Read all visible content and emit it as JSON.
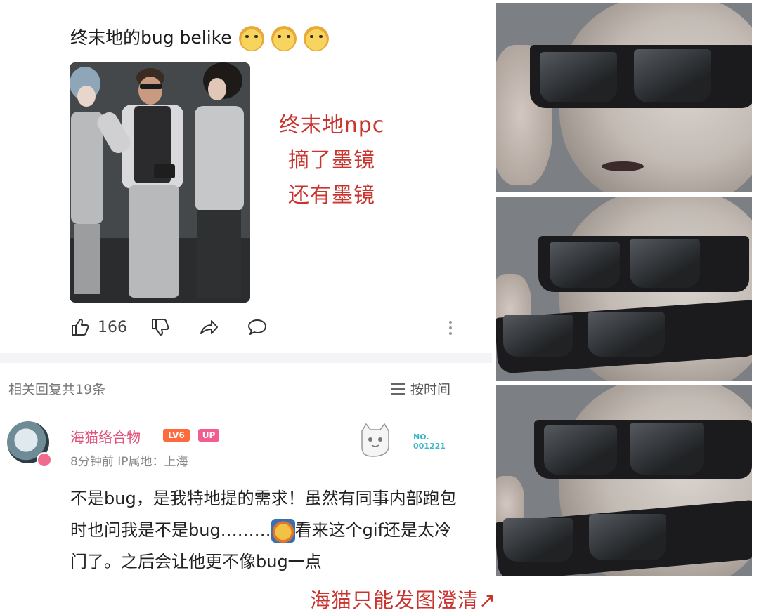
{
  "post": {
    "title": "终末地的bug belike",
    "emojis": [
      "doge-emoji",
      "doge-emoji",
      "doge-emoji"
    ],
    "caption_lines": [
      "终末地npc",
      "摘了墨镜",
      "还有墨镜"
    ],
    "likes": "166"
  },
  "replies": {
    "count_label": "相关回复共19条",
    "sort_label": "按时间"
  },
  "comment": {
    "username": "海猫络合物",
    "level": "LV6",
    "up_badge": "UP",
    "time": "8分钟前",
    "ip_location": "IP属地：上海",
    "fan_badge_no": "NO.",
    "fan_badge_num": "001221",
    "text_part1": "不是bug，是我特地提的需求！虽然有同事内部跑包时也问我是不是bug………",
    "text_part2": "看来这个gif还是太冷门了。之后会让他更不像bug一点"
  },
  "annotation": "海猫只能发图澄清↗",
  "colors": {
    "caption_red": "#c9342f",
    "username_pink": "#e0527a",
    "level_orange": "#ff6a3d",
    "up_pink": "#f25d8e"
  }
}
